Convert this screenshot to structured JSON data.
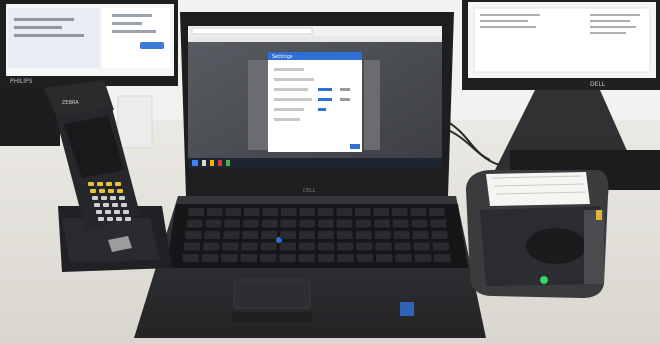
{
  "brands": {
    "left_monitor": "PHILIPS",
    "right_monitor": "DELL",
    "scanner": "ZEBRA",
    "laptop": "DELL"
  },
  "dialog": {
    "title": "Settings"
  },
  "colors": {
    "desk": "#e4e2dc",
    "wall": "#f3f3f1",
    "laptop_body": "#2b2c2e",
    "keyboard": "#1b1c1e",
    "screen_bg": "#4a4c52",
    "dialog_accent": "#2e6fd6",
    "scanner_keys": "#e8c23a",
    "printer_body": "#3a3b3d",
    "receipt": "#f7f6f2"
  }
}
